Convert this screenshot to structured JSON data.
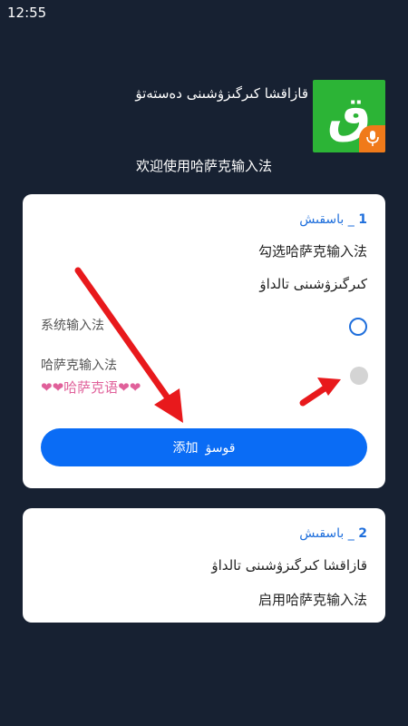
{
  "status_bar": {
    "time": "12:55"
  },
  "header": {
    "app_name": "قازاقشا كىرگىزۋشىنى دەستەتۋ",
    "icon_glyph": "ق",
    "welcome": "欢迎使用哈萨克输入法"
  },
  "step1": {
    "number": "1",
    "separator": "_",
    "label": "باسقىش",
    "text_zh": "勾选哈萨克输入法",
    "text_kk": "كىرگىزۋشىنى تالداۋ",
    "options": [
      {
        "label": "系统输入法",
        "state": "unselected"
      },
      {
        "label": "哈萨克输入法",
        "sub": "❤❤哈萨克语❤❤",
        "state": "disabled"
      }
    ],
    "add_button": {
      "label_zh": "添加",
      "label_kk": "قوسۋ"
    }
  },
  "step2": {
    "number": "2",
    "separator": "_",
    "label": "باسقىش",
    "text_kk": "قازاقشا كىرگىزۋشىنى تالداۋ",
    "text_zh": "启用哈萨克输入法"
  },
  "colors": {
    "background": "#172132",
    "card": "#ffffff",
    "accent": "#0a6cf5",
    "step_title": "#1f6fdc",
    "arrow": "#e8191c",
    "app_icon_bg": "#2cb436",
    "mic_badge": "#f07a1a"
  },
  "icons": {
    "app_icon": "kazakh-letter-icon",
    "mic": "microphone-icon",
    "annotation": "red-arrow-icon"
  }
}
